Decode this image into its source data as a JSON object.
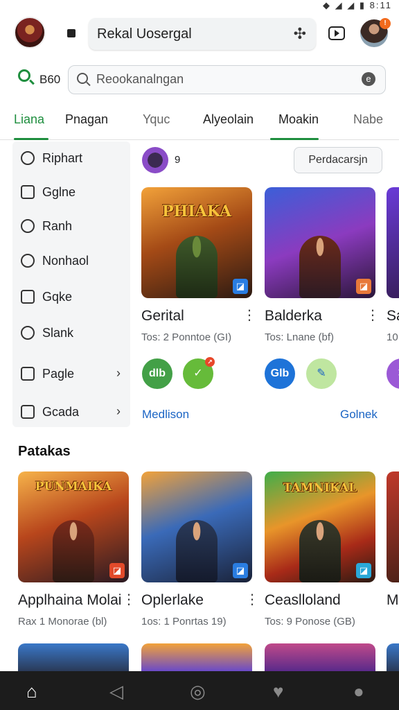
{
  "status": {
    "time": "8:11",
    "icons": "◆ ◢ ◢ ▮"
  },
  "header": {
    "title": "Rekal Uosergal"
  },
  "search": {
    "code": "B60",
    "placeholder": "Reookanalngan",
    "badge": "e"
  },
  "tabs": [
    {
      "label": "Liana",
      "active": true
    },
    {
      "label": "Pnagan",
      "active": false
    },
    {
      "label": "Yquc",
      "active": false
    },
    {
      "label": "Alyeolain",
      "active": false
    },
    {
      "label": "Moakin",
      "active": false
    },
    {
      "label": "Nabe",
      "active": false
    }
  ],
  "sidebar": {
    "items": [
      {
        "label": "Riphart",
        "icon": "target-icon",
        "chevron": ""
      },
      {
        "label": "Gglne",
        "icon": "library-icon",
        "chevron": ""
      },
      {
        "label": "Ranh",
        "icon": "heart-icon",
        "chevron": ""
      },
      {
        "label": "Nonhaol",
        "icon": "clock-icon",
        "chevron": ""
      },
      {
        "label": "Gqke",
        "icon": "smiley-icon",
        "chevron": ""
      },
      {
        "label": "Slank",
        "icon": "shield-icon",
        "chevron": ""
      },
      {
        "label": "Pagle",
        "icon": "camera-icon",
        "chevron": "›"
      },
      {
        "label": "Gcada",
        "icon": "face-icon",
        "chevron": "›"
      }
    ]
  },
  "featured": {
    "count": "9",
    "button_label": "Perdacarsjn",
    "cards": [
      {
        "art_title": "PHIAKA",
        "name": "Gerital",
        "sub": "Tos: 2 Ponntoe (GI)"
      },
      {
        "art_title": "",
        "name": "Balderka",
        "sub": "Tos: Lnane (bf)"
      },
      {
        "art_title": "",
        "name": "Sa",
        "sub": "10"
      }
    ],
    "app_badges": [
      "dlb",
      "✓",
      "Glb",
      "✎",
      "✕"
    ],
    "links": [
      "Medlison",
      "Golnek"
    ]
  },
  "section2": {
    "title": "Patakas",
    "cards": [
      {
        "art_title": "PUNMAIKA",
        "name": "Applhaina Molai",
        "sub": "Rax 1 Monorae (bl)"
      },
      {
        "art_title": "",
        "name": "Oplerlake",
        "sub": "1os: 1 Ponrtas 19)"
      },
      {
        "art_title": "TAMNIKAL",
        "name": "Ceaslloland",
        "sub": "Tos: 9 Ponose (GB)"
      },
      {
        "art_title": "",
        "name": "M",
        "sub": ""
      }
    ]
  },
  "colors": {
    "accent": "#1e8e3e",
    "link": "#1a64c4",
    "navbar": "#1c1c1c"
  }
}
